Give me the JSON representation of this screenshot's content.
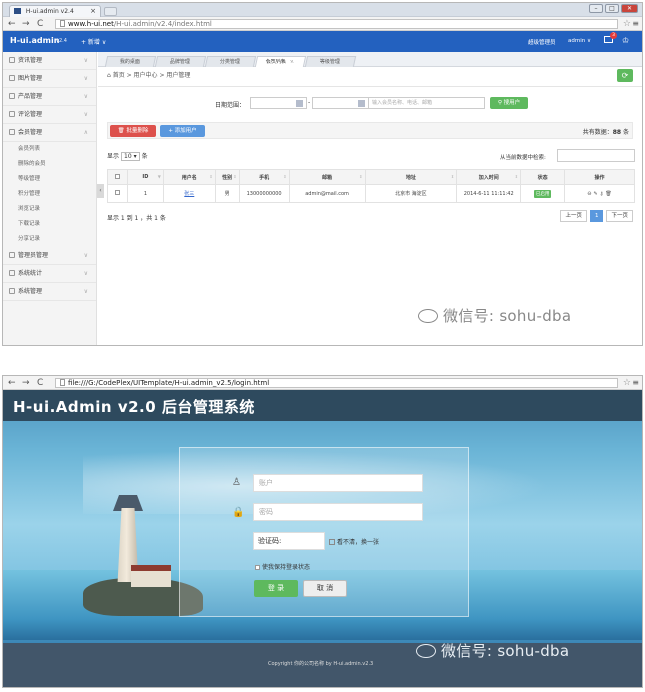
{
  "shot1": {
    "browser": {
      "tab_title": "H-ui.admin v2.4",
      "tab_close": "×",
      "url_host": "www.h-ui.net",
      "url_path": "/H-ui.admin/v2.4/index.html"
    },
    "header": {
      "logo": "H-ui.admin",
      "version": "v2.4",
      "new_menu": "+ 新增 ∨",
      "role": "超级管理员",
      "user": "admin ∨",
      "mail_badge": "3"
    },
    "sidebar": {
      "items": [
        {
          "label": "资讯管理"
        },
        {
          "label": "图片管理"
        },
        {
          "label": "产品管理"
        },
        {
          "label": "评论管理"
        },
        {
          "label": "会员管理"
        }
      ],
      "subitems": [
        "会员列表",
        "删除的会员",
        "等级管理",
        "积分管理",
        "浏览记录",
        "下载记录",
        "分享记录"
      ],
      "items_after": [
        {
          "label": "管理员管理"
        },
        {
          "label": "系统统计"
        },
        {
          "label": "系统管理"
        }
      ]
    },
    "content_tabs": [
      {
        "label": "我的桌面"
      },
      {
        "label": "品牌管理"
      },
      {
        "label": "分类管理"
      },
      {
        "label": "会员列表",
        "close": "×"
      },
      {
        "label": "等级管理"
      }
    ],
    "breadcrumb": "首页 > 用户中心 > 用户管理",
    "filter": {
      "date_label": "日期范围：",
      "dash": "-",
      "search_placeholder": "输入会员名称、电话、邮箱",
      "search_button": "搜用户"
    },
    "actions": {
      "bulk_delete": "批量删除",
      "add_user": "+ 添加用户",
      "total_label": "共有数据：",
      "total_count": "88",
      "total_unit": "条"
    },
    "length": {
      "prefix": "显示",
      "value": "10",
      "suffix": "条"
    },
    "search_label": "从当前数据中检索:",
    "table": {
      "headers": [
        "",
        "ID",
        "用户名",
        "性别",
        "手机",
        "邮箱",
        "地址",
        "加入时间",
        "状态",
        "操作"
      ],
      "rows": [
        {
          "id": "1",
          "name": "张三",
          "gender": "男",
          "phone": "13000000000",
          "email": "admin@mail.com",
          "address": "北京市 海淀区",
          "joined": "2014-6-11 11:11:42",
          "status": "已启用"
        }
      ]
    },
    "page_info": "显示 1 到 1 ，共 1 条",
    "pager": {
      "prev": "上一页",
      "current": "1",
      "next": "下一页"
    },
    "watermark": "微信号: sohu-dba"
  },
  "shot2": {
    "browser": {
      "url": "file:///G:/CodePlex/UITemplate/H-ui.admin_v2.5/login.html"
    },
    "title": "H-ui.Admin v2.0 后台管理系统",
    "form": {
      "account_placeholder": "账户",
      "password_placeholder": "密码",
      "captcha_placeholder": "验证码:",
      "captcha_hint": "看不清，换一张",
      "remember": "使我保持登录状态",
      "login": "登  录",
      "cancel": "取  消"
    },
    "footer": "Copyright 你的公司名称 by H-ui.admin.v2.3",
    "watermark": "微信号: sohu-dba"
  },
  "colors": {
    "header_blue": "#2361bf",
    "success_green": "#5eb95e",
    "danger_red": "#dd514c",
    "primary_blue": "#5a98de"
  }
}
